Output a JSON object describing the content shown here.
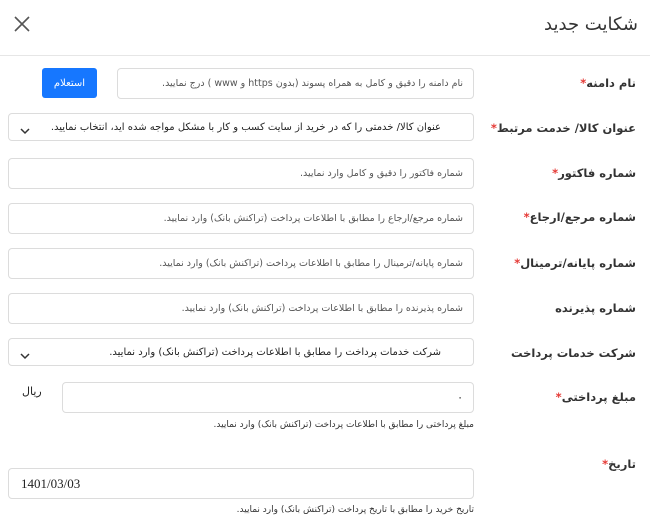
{
  "header": {
    "title": "شکایت جدید",
    "close_icon": "close-icon"
  },
  "domain": {
    "label": "نام دامنه",
    "placeholder": "نام دامنه را دقیق و کامل به همراه پسوند (بدون https و www ) درج نمایید.",
    "button_label": "استعلام"
  },
  "product": {
    "label": "عنوان کالا/ خدمت مرتبط",
    "selected": "عنوان کالا/ خدمتی را که در خرید از سایت کسب و کار با مشکل مواجه شده اید، انتخاب نمایید."
  },
  "invoice": {
    "label": "شماره فاکتور",
    "placeholder": "شماره فاکتور را دقیق و کامل وارد نمایید."
  },
  "reference": {
    "label": "شماره مرجع/ارجاع",
    "placeholder": "شماره مرجع/ارجاع را مطابق با اطلاعات پرداخت (تراکنش بانک) وارد نمایید."
  },
  "terminal": {
    "label": "شماره پایانه/ترمینال",
    "placeholder": "شماره پایانه/ترمینال را مطابق با اطلاعات پرداخت (تراکنش بانک) وارد نمایید."
  },
  "acceptor": {
    "label": "شماره پذیرنده",
    "placeholder": "شماره پذیرنده را مطابق با اطلاعات پرداخت (تراکنش بانک) وارد نمایید."
  },
  "payment_company": {
    "label": "شرکت خدمات پرداخت",
    "selected": "شرکت خدمات پرداخت را مطابق با اطلاعات پرداخت (تراکنش بانک) وارد نمایید."
  },
  "amount": {
    "label": "مبلغ پرداختی",
    "value": "۰",
    "unit": "ریال",
    "hint": "مبلغ پرداختی را مطابق با اطلاعات پرداخت (تراکنش بانک) وارد نمایید."
  },
  "date": {
    "label": "تاریخ",
    "value": "1401/03/03",
    "hint": "تاریخ خرید را مطابق با تاریخ پرداخت (تراکنش بانک) وارد نمایید."
  },
  "required_mark": "*",
  "colors": {
    "accent": "#1677ff",
    "required": "#e53935",
    "border": "#dcdcdc"
  }
}
